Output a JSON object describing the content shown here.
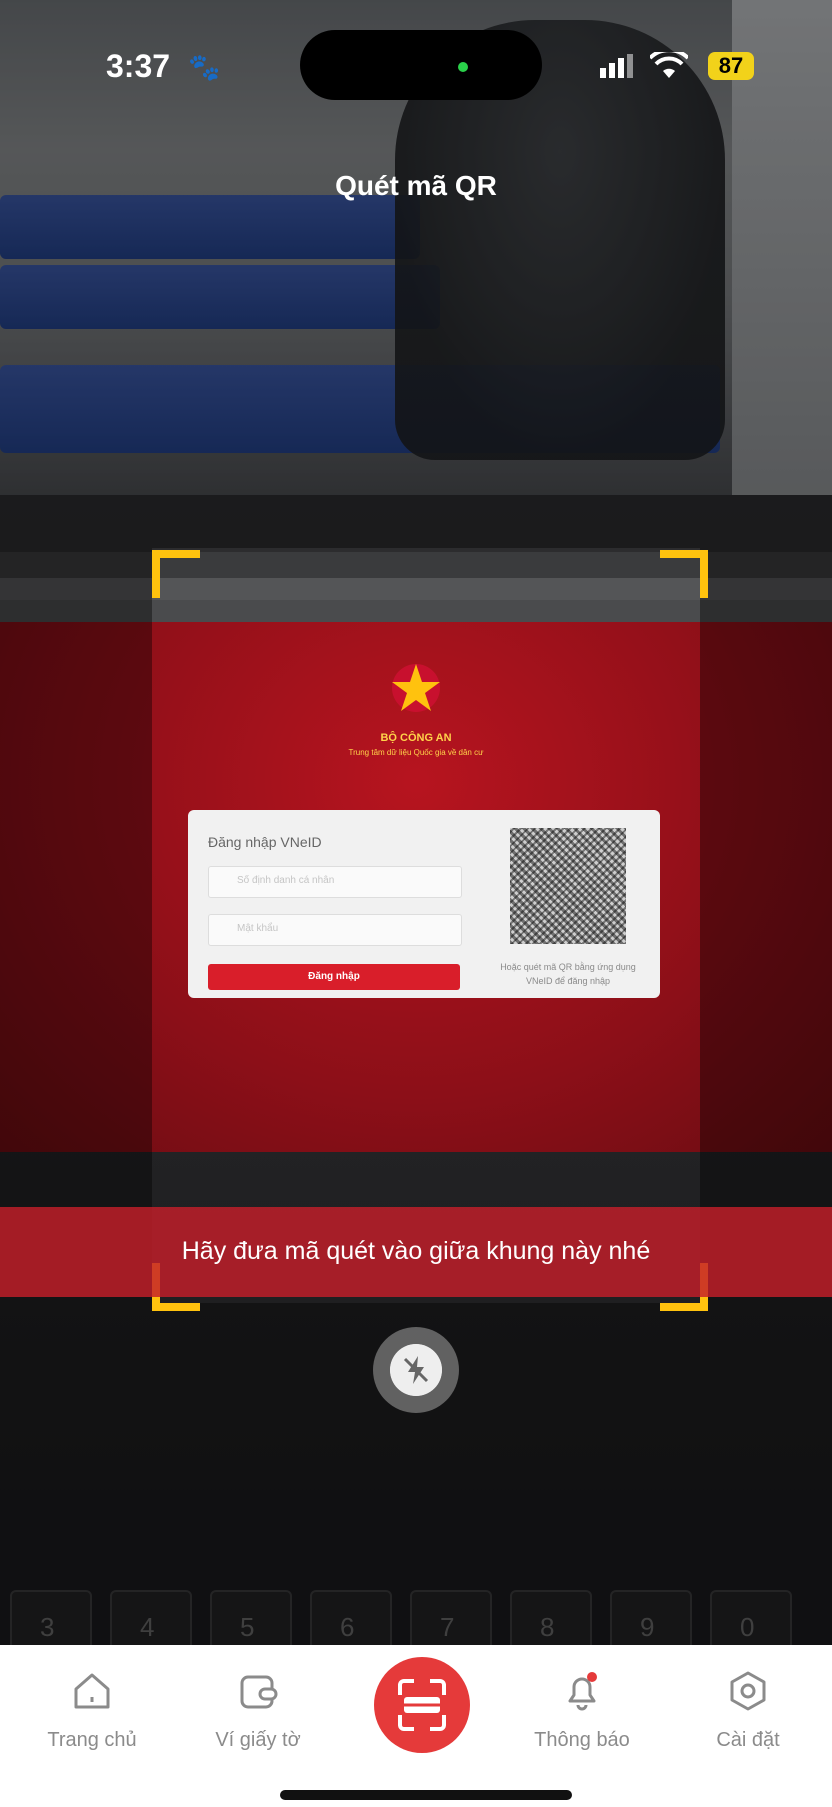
{
  "status_bar": {
    "time": "3:37",
    "battery": "87"
  },
  "header": {
    "title": "Quét mã QR"
  },
  "camera_view": {
    "login_page": {
      "agency_name": "BỘ CÔNG AN",
      "agency_subtitle": "Trung tâm dữ liệu Quốc gia về dân cư",
      "login_title": "Đăng nhập VNeID",
      "id_placeholder": "Số định danh cá nhân",
      "password_placeholder": "Mật khẩu",
      "login_button": "Đăng nhập",
      "qr_note": "Hoặc quét mã QR bằng ứng dụng VNeID để đăng nhập"
    },
    "keyboard_keys": [
      "3",
      "4",
      "5",
      "6",
      "7",
      "8",
      "9",
      "0"
    ]
  },
  "scanner": {
    "hint": "Hãy đưa mã quét vào giữa khung này nhé",
    "frame_color": "#ffc20e"
  },
  "bottom_nav": {
    "items": [
      {
        "label": "Trang chủ",
        "icon": "home-icon"
      },
      {
        "label": "Ví giấy tờ",
        "icon": "wallet-icon"
      },
      {
        "label": "",
        "icon": "scan-icon"
      },
      {
        "label": "Thông báo",
        "icon": "bell-icon"
      },
      {
        "label": "Cài đặt",
        "icon": "settings-icon"
      }
    ],
    "accent": "#e53a3a"
  }
}
